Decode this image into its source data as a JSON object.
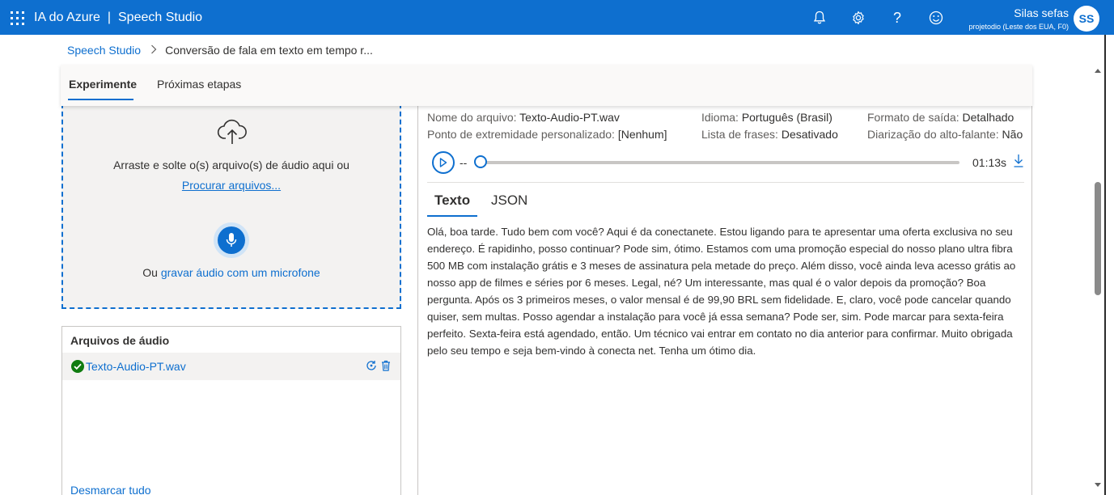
{
  "header": {
    "product": "IA do Azure",
    "separator": "|",
    "app": "Speech Studio",
    "user_name": "Silas sefas",
    "user_sub": "projetodio (Leste dos EUA, F0)",
    "avatar_initials": "SS",
    "accent_color": "#0e6fcf"
  },
  "breadcrumb": {
    "root": "Speech Studio",
    "current": "Conversão de fala em texto em tempo r..."
  },
  "tabs": [
    {
      "label": "Experimente",
      "active": true
    },
    {
      "label": "Próximas etapas",
      "active": false
    }
  ],
  "upload": {
    "drag_text": "Arraste e solte o(s) arquivo(s) de áudio aqui ou",
    "browse_link": "Procurar arquivos...",
    "record_prefix": "Ou",
    "record_link": "gravar áudio com um microfone"
  },
  "files": {
    "title": "Arquivos de áudio",
    "items": [
      {
        "name": "Texto-Audio-PT.wav",
        "status": "success"
      }
    ],
    "deselect_all": "Desmarcar tudo"
  },
  "details": {
    "file_name_label": "Nome do arquivo:",
    "file_name_value": "Texto-Audio-PT.wav",
    "language_label": "Idioma:",
    "language_value": "Português (Brasil)",
    "output_label": "Formato de saída:",
    "output_value": "Detalhado",
    "endpoint_label": "Ponto de extremidade personalizado:",
    "endpoint_value": "[Nenhum]",
    "phrases_label": "Lista de frases:",
    "phrases_value": "Desativado",
    "diarization_label": "Diarização do alto-falante:",
    "diarization_value": "Não"
  },
  "player": {
    "current_time": "--",
    "duration": "01:13s",
    "progress": 0
  },
  "result_tabs": [
    {
      "label": "Texto",
      "active": true
    },
    {
      "label": "JSON",
      "active": false
    }
  ],
  "transcript": "Olá, boa tarde. Tudo bem com você? Aqui é da conectanete. Estou ligando para te apresentar uma oferta exclusiva no seu endereço. É rapidinho, posso continuar? Pode sim, ótimo. Estamos com uma promoção especial do nosso plano ultra fibra 500 MB com instalação grátis e 3 meses de assinatura pela metade do preço. Além disso, você ainda leva acesso grátis ao nosso app de filmes e séries por 6 meses. Legal, né? Um interessante, mas qual é o valor depois da promoção? Boa pergunta. Após os 3 primeiros meses, o valor mensal é de 99,90 BRL sem fidelidade. E, claro, você pode cancelar quando quiser, sem multas. Posso agendar a instalação para você já essa semana? Pode ser, sim. Pode marcar para sexta-feira perfeito. Sexta-feira está agendado, então. Um técnico vai entrar em contato no dia anterior para confirmar. Muito obrigada pelo seu tempo e seja bem-vindo à conecta net. Tenha um ótimo dia.",
  "icons": {
    "waffle": "waffle-icon",
    "bell": "bell-icon",
    "settings": "gear-icon",
    "help": "help-icon",
    "feedback": "smiley-icon",
    "upload": "cloud-upload-icon",
    "mic": "microphone-icon",
    "success": "check-circle-icon",
    "rerun": "refresh-icon",
    "delete": "trash-icon",
    "play": "play-icon",
    "download": "download-icon"
  }
}
